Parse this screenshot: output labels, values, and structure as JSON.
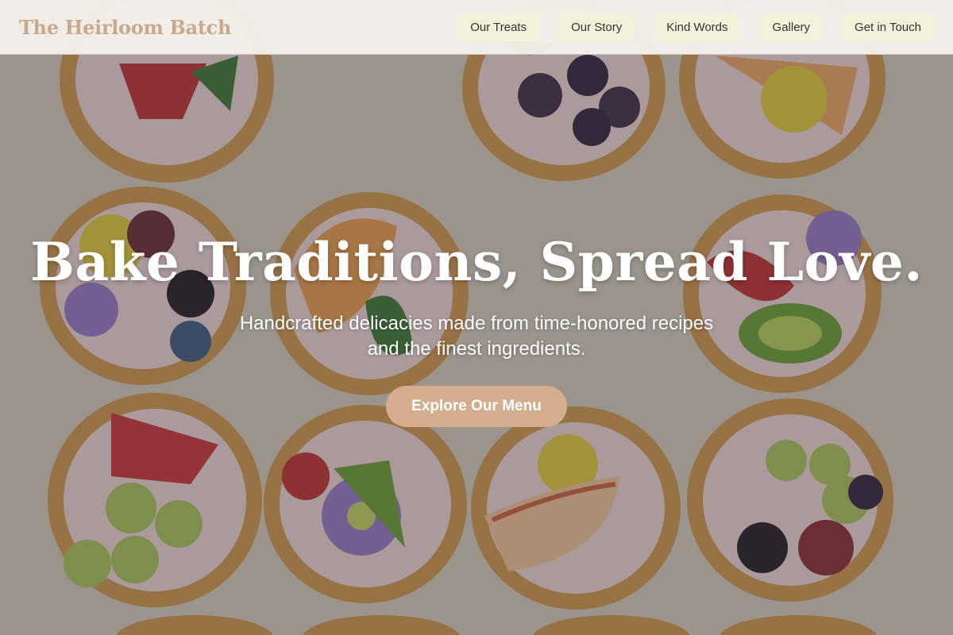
{
  "brand": {
    "name": "The Heirloom Batch"
  },
  "nav": {
    "items": [
      {
        "label": "Our Treats"
      },
      {
        "label": "Our Story"
      },
      {
        "label": "Kind Words"
      },
      {
        "label": "Gallery"
      },
      {
        "label": "Get in Touch"
      }
    ]
  },
  "hero": {
    "title": "Bake Traditions, Spread Love.",
    "subtitle": "Handcrafted delicacies made from time-honored recipes and the finest ingredients.",
    "cta_label": "Explore Our Menu",
    "background_image": "pastry-tarts-icon"
  },
  "colors": {
    "brand": "#c8a98c",
    "nav_button_bg": "#f3f0dc",
    "cta_bg": "#d3ad8c",
    "hero_text": "#ffffff"
  }
}
